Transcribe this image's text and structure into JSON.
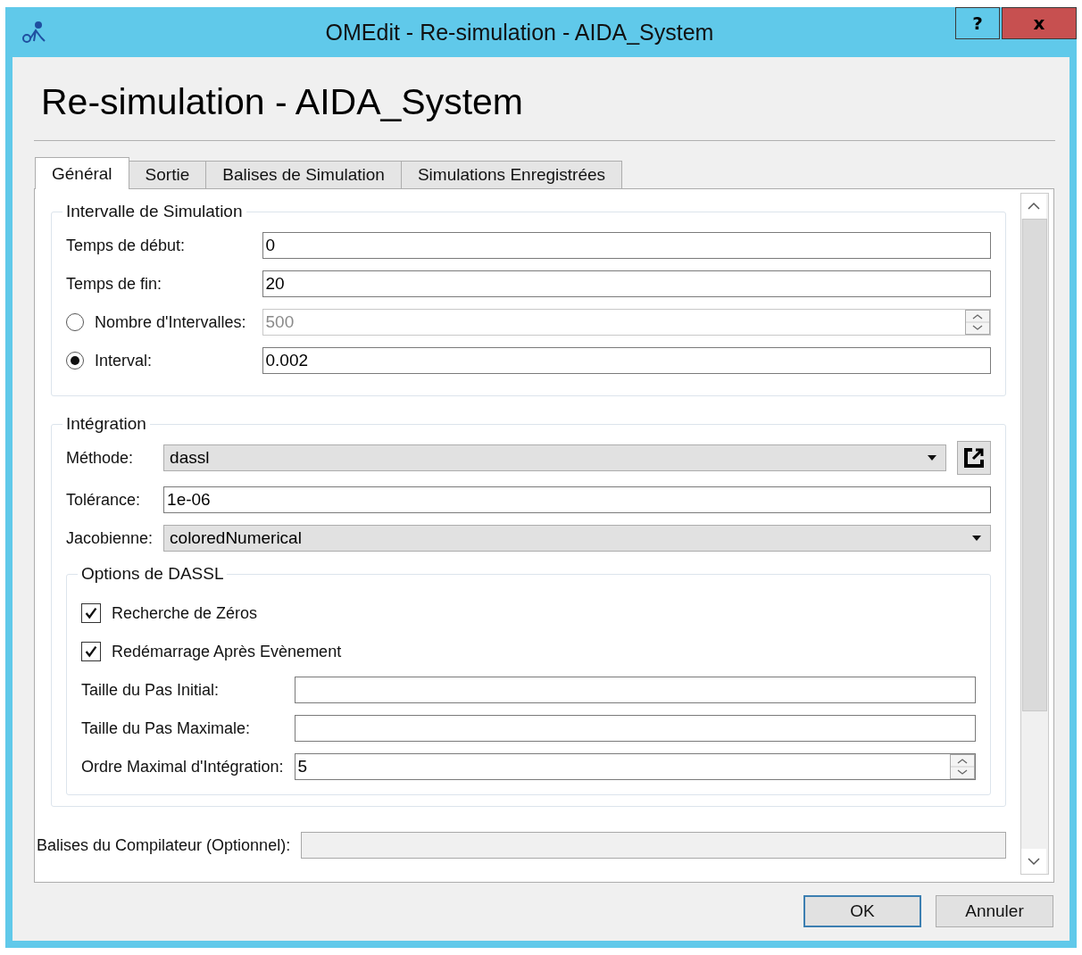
{
  "window": {
    "title": "OMEdit - Re-simulation - AIDA_System",
    "help": "?",
    "close": "x"
  },
  "heading": "Re-simulation - AIDA_System",
  "tabs": [
    {
      "label": "Général",
      "selected": true
    },
    {
      "label": "Sortie",
      "selected": false
    },
    {
      "label": "Balises de Simulation",
      "selected": false
    },
    {
      "label": "Simulations Enregistrées",
      "selected": false
    }
  ],
  "interval_group": {
    "title": "Intervalle de Simulation",
    "rows": [
      {
        "kind": "text",
        "label": "Temps de début:",
        "value": "0"
      },
      {
        "kind": "text",
        "label": "Temps de fin:",
        "value": "20"
      },
      {
        "kind": "radio-spin",
        "label": "Nombre d'Intervalles:",
        "value": "500",
        "selected": false,
        "disabled": true
      },
      {
        "kind": "radio-text",
        "label": "Interval:",
        "value": "0.002",
        "selected": true,
        "disabled": false
      }
    ]
  },
  "integration_group": {
    "title": "Intégration",
    "rows": [
      {
        "kind": "combo-link",
        "label": "Méthode:",
        "value": "dassl"
      },
      {
        "kind": "text",
        "label": "Tolérance:",
        "value": "1e-06"
      },
      {
        "kind": "combo",
        "label": "Jacobienne:",
        "value": "coloredNumerical"
      }
    ],
    "options_group": {
      "title": "Options de DASSL",
      "rows": [
        {
          "kind": "check",
          "label": "Recherche de Zéros",
          "checked": true
        },
        {
          "kind": "check",
          "label": "Redémarrage Après Evènement",
          "checked": true
        },
        {
          "kind": "text",
          "label": "Taille du Pas Initial:"
        },
        {
          "kind": "text",
          "label": "Taille du Pas Maximale:"
        },
        {
          "kind": "spin",
          "label": "Ordre Maximal d'Intégration:",
          "value": "5"
        }
      ]
    }
  },
  "compiler_flags": {
    "label": "Balises du Compilateur (Optionnel):",
    "disabled": true
  },
  "buttons": [
    {
      "label": "OK",
      "default": true
    },
    {
      "label": "Annuler",
      "default": false
    }
  ]
}
